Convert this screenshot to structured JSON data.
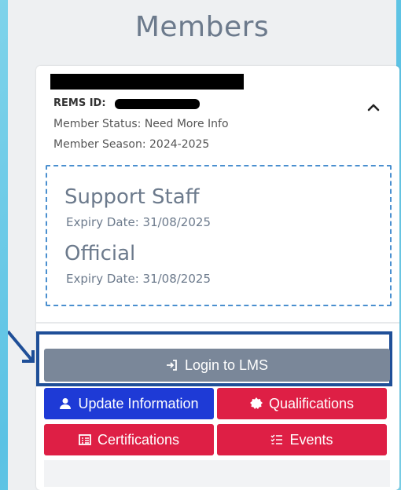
{
  "page": {
    "title": "Members"
  },
  "member": {
    "rems_label": "REMS ID:",
    "status": "Member Status: Need More Info",
    "season": "Member Season: 2024-2025",
    "licenses": [
      {
        "name": "Support Staff",
        "expiry": "Expiry Date: 31/08/2025"
      },
      {
        "name": "Official",
        "expiry": "Expiry Date: 31/08/2025"
      }
    ]
  },
  "actions": {
    "login": "Login to LMS",
    "update": "Update Information",
    "qualifications": "Qualifications",
    "certifications": "Certifications",
    "events": "Events"
  },
  "colors": {
    "login_bg": "#7a8799",
    "update_bg": "#1e3ad6",
    "red_bg": "#de1f45",
    "highlight": "#1f4f98"
  },
  "icons": {
    "collapse": "chevron-up-icon",
    "login": "sign-in-icon",
    "update": "user-icon",
    "qualifications": "badge-icon",
    "certifications": "list-alt-icon",
    "events": "list-check-icon"
  }
}
